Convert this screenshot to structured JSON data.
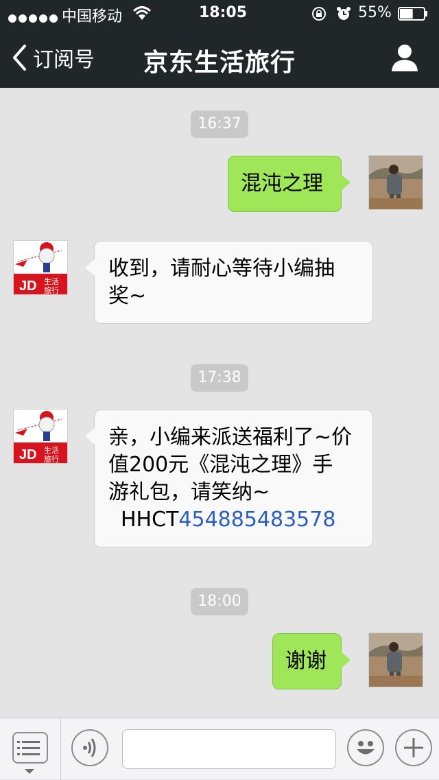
{
  "status_bar": {
    "carrier": "中国移动",
    "time": "18:05",
    "battery_percent": "55%",
    "battery_level": 0.55,
    "signal_bars": 5
  },
  "nav": {
    "back_label": "订阅号",
    "title": "京东生活旅行"
  },
  "messages": [
    {
      "type": "time",
      "text": "16:37"
    },
    {
      "type": "outgoing",
      "text": "混沌之理"
    },
    {
      "type": "incoming",
      "lines": [
        "收到，请耐心等待小编抽",
        "奖~"
      ]
    },
    {
      "type": "time",
      "text": "17:38"
    },
    {
      "type": "incoming",
      "lines": [
        "亲，小编来派送福利了~价",
        "值200元《混沌之理》手",
        "游礼包，请笑纳~"
      ],
      "code_prefix": "HHCT",
      "code_number": "454885483578"
    },
    {
      "type": "time",
      "text": "18:00"
    },
    {
      "type": "outgoing",
      "text": "谢谢"
    }
  ],
  "jd_logo": {
    "brand": "JD",
    "line1": "生活",
    "line2": "旅行"
  },
  "colors": {
    "nav_bg": "#212629",
    "chat_bg": "#e4e4e4",
    "outgoing_bubble": "#9fe759",
    "incoming_bubble": "#f9f9f9",
    "link": "#2b5fbf",
    "jd_red": "#d7141e"
  },
  "icons": {
    "back": "chevron-left-icon",
    "profile": "person-icon",
    "menu": "list-menu-icon",
    "voice": "voice-icon",
    "emoji": "smiley-icon",
    "plus": "plus-icon"
  }
}
